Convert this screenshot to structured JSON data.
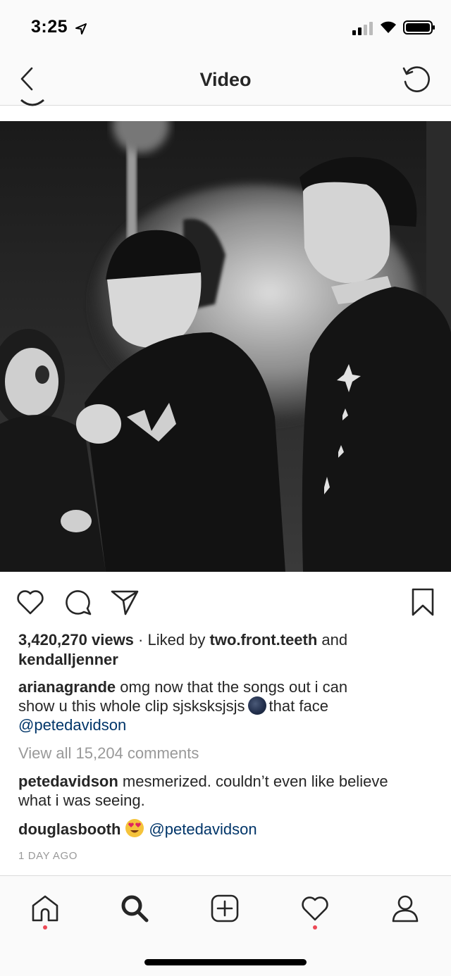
{
  "status_bar": {
    "time": "3:25"
  },
  "header": {
    "title": "Video"
  },
  "post": {
    "views": "3,420,270 views",
    "separator": " · ",
    "liked_by_prefix": "Liked by ",
    "liked_by_user": "two.front.teeth",
    "liked_by_and": " and",
    "liked_by_user2": "kendalljenner",
    "caption": {
      "username": "arianagrande",
      "text_line1": " omg now that the songs out i can",
      "text_line2a": "show u this whole clip sjsksksjsjs",
      "text_line2b": "that face",
      "mention": "@petedavidson"
    },
    "view_all_comments": "View all 15,204 comments",
    "comments": [
      {
        "username": "petedavidson",
        "text_line1": " mesmerized. couldn’t even like believe",
        "text_line2": "what i was seeing."
      },
      {
        "username": "douglasbooth",
        "mention": "@petedavidson"
      }
    ],
    "timestamp": "1 DAY AGO"
  },
  "icons": {
    "status": [
      "location-arrow-icon",
      "cellular-signal-icon",
      "wifi-icon",
      "battery-icon"
    ],
    "header": [
      "back-chevron-icon",
      "refresh-icon"
    ],
    "actions": [
      "heart-icon",
      "comment-icon",
      "share-icon",
      "bookmark-icon"
    ],
    "tabs": [
      "home-icon",
      "search-icon",
      "new-post-icon",
      "activity-icon",
      "profile-icon"
    ]
  },
  "colors": {
    "mention": "#003569",
    "muted": "#999999",
    "notification_dot": "#ed4956",
    "text": "#262626"
  }
}
